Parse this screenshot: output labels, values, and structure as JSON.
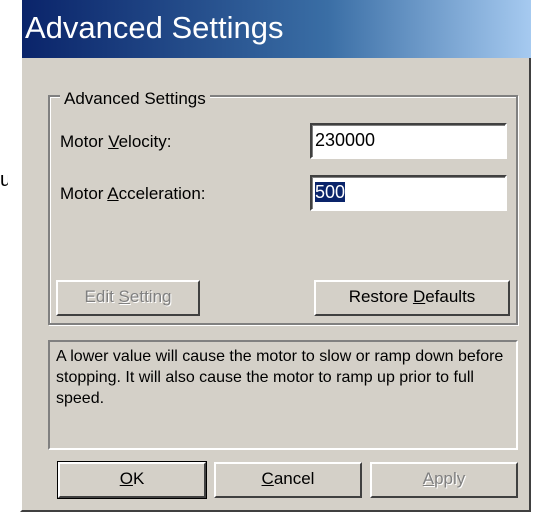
{
  "stray_text": "u",
  "dialog": {
    "title": "Advanced Settings",
    "group_title": "Advanced Settings",
    "velocity": {
      "label_pre": "Motor ",
      "label_u": "V",
      "label_post": "elocity:",
      "value": "230000"
    },
    "acceleration": {
      "label_pre": "Motor ",
      "label_u": "A",
      "label_post": "cceleration:",
      "value": "500"
    },
    "edit_setting": {
      "pre": "E",
      "sp": "dit ",
      "u": "S",
      "post": "etting"
    },
    "restore_defaults": {
      "pre": "Restore ",
      "u": "D",
      "post": "efaults"
    },
    "description": "A lower value will cause the motor to slow or ramp down before stopping. It will also cause the motor to ramp up prior to full speed.",
    "ok": {
      "u": "O",
      "post": "K"
    },
    "cancel": {
      "u": "C",
      "post": "ancel"
    },
    "apply": {
      "u": "A",
      "post": "pply"
    }
  }
}
